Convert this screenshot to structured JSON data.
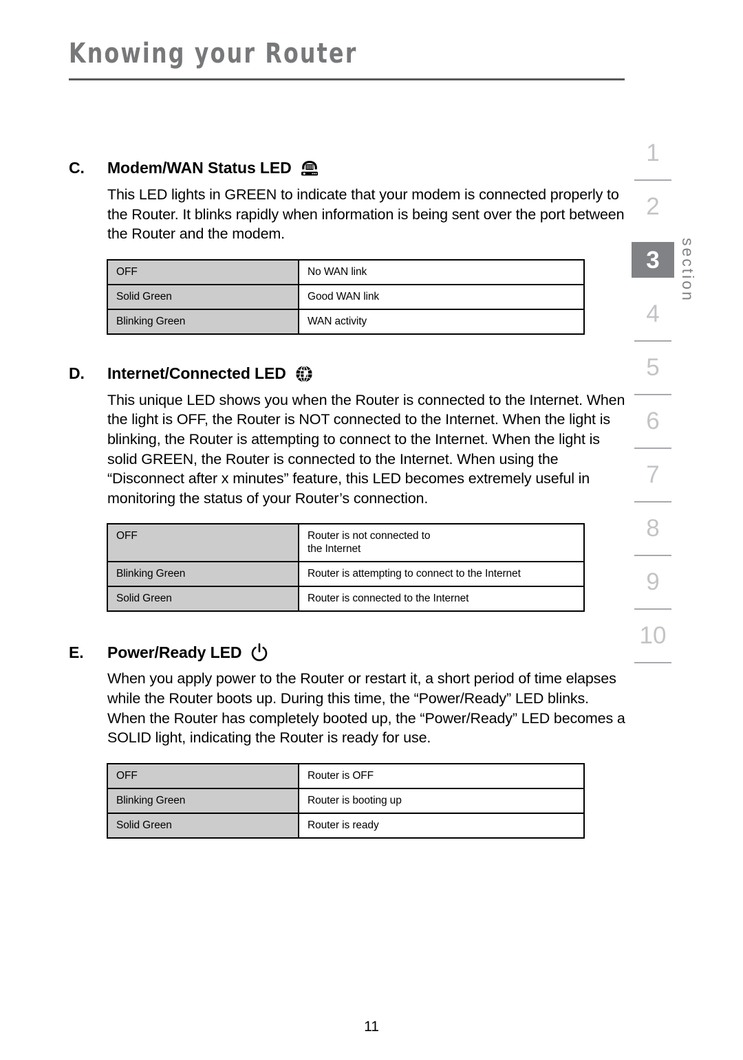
{
  "header": {
    "title": "Knowing your Router"
  },
  "sections": [
    {
      "letter": "C.",
      "title": "Modem/WAN Status LED",
      "icon": "modem-icon",
      "body": "This LED lights in GREEN to indicate that your modem is connected properly to the Router. It blinks rapidly when information is being sent over the port between the Router and the modem.",
      "table": {
        "rows": [
          {
            "state": "OFF",
            "meaning": "No WAN link"
          },
          {
            "state": "Solid Green",
            "meaning": "Good WAN link"
          },
          {
            "state": "Blinking Green",
            "meaning": "WAN activity"
          }
        ]
      }
    },
    {
      "letter": "D.",
      "title": "Internet/Connected LED",
      "icon": "globe-icon",
      "body": "This unique LED shows you when the Router is connected to the Internet. When the light is OFF, the Router is NOT connected to the Internet. When the light is blinking, the Router is attempting to connect to the Internet. When the light is solid GREEN, the Router is connected to the Internet. When using the “Disconnect after x minutes” feature, this LED becomes extremely useful in monitoring the status of your Router’s connection.",
      "table": {
        "rows": [
          {
            "state": "OFF",
            "meaning": "Router is not connected to\nthe Internet"
          },
          {
            "state": "Blinking Green",
            "meaning": "Router is attempting to connect to the Internet"
          },
          {
            "state": "Solid Green",
            "meaning": "Router is connected to the Internet"
          }
        ]
      }
    },
    {
      "letter": "E.",
      "title": "Power/Ready LED",
      "icon": "power-icon",
      "body": "When you apply power to the Router or restart it, a short period of time elapses while the Router boots up. During this time, the “Power/Ready” LED blinks. When the Router has completely booted up, the “Power/Ready” LED becomes a SOLID light, indicating the Router is ready for use.",
      "table": {
        "rows": [
          {
            "state": "OFF",
            "meaning": "Router is OFF"
          },
          {
            "state": "Blinking Green",
            "meaning": "Router is booting up"
          },
          {
            "state": "Solid Green",
            "meaning": "Router is ready"
          }
        ]
      }
    }
  ],
  "section_index": {
    "label": "section",
    "active": "3",
    "numbers": [
      "1",
      "2",
      "3",
      "4",
      "5",
      "6",
      "7",
      "8",
      "9",
      "10"
    ]
  },
  "footer": {
    "page_number": "11"
  },
  "colors": {
    "header_text": "#77787a",
    "table_state_bg": "#cccccc",
    "index_inactive": "#c3c4c6",
    "index_active_bg": "#808285"
  }
}
